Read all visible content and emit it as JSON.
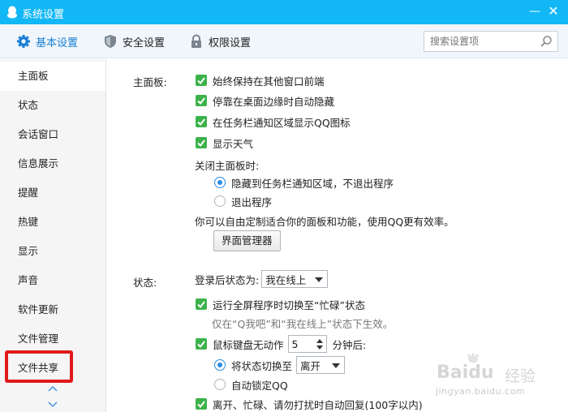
{
  "window": {
    "title": "系统设置"
  },
  "tabs": [
    {
      "label": "基本设置",
      "icon": "gear-icon",
      "active": true
    },
    {
      "label": "安全设置",
      "icon": "shield-icon",
      "active": false
    },
    {
      "label": "权限设置",
      "icon": "lock-icon",
      "active": false
    }
  ],
  "search": {
    "placeholder": "搜索设置项"
  },
  "sidebar": {
    "items": [
      {
        "label": "主面板",
        "active": true
      },
      {
        "label": "状态"
      },
      {
        "label": "会话窗口"
      },
      {
        "label": "信息展示"
      },
      {
        "label": "提醒"
      },
      {
        "label": "热键"
      },
      {
        "label": "显示"
      },
      {
        "label": "声音"
      },
      {
        "label": "软件更新"
      },
      {
        "label": "文件管理"
      },
      {
        "label": "文件共享",
        "highlighted": true
      }
    ]
  },
  "main_panel": {
    "label": "主面板:",
    "checkboxes": [
      {
        "label": "始终保持在其他窗口前端",
        "checked": true
      },
      {
        "label": "停靠在桌面边缘时自动隐藏",
        "checked": true
      },
      {
        "label": "在任务栏通知区域显示QQ图标",
        "checked": true
      },
      {
        "label": "显示天气",
        "checked": true
      }
    ],
    "close_label": "关闭主面板时:",
    "close_options": [
      {
        "label": "隐藏到任务栏通知区域，不退出程序",
        "selected": true
      },
      {
        "label": "退出程序",
        "selected": false
      }
    ],
    "customize_text": "你可以自由定制适合你的面板和功能，使用QQ更有效率。",
    "manager_button": "界面管理器"
  },
  "status_panel": {
    "label": "状态:",
    "login_status_label": "登录后状态为:",
    "login_status_value": "我在线上",
    "fullscreen_busy": {
      "label": "运行全屏程序时切换至“忙碌”状态",
      "checked": true
    },
    "fullscreen_hint": "仅在“Q我吧”和“我在线上”状态下生效。",
    "idle_label": "鼠标键盘无动作",
    "idle_minutes": "5",
    "idle_suffix": "分钟后:",
    "idle_checked": true,
    "idle_options": [
      {
        "label": "将状态切换至",
        "selected": true,
        "select_value": "离开"
      },
      {
        "label": "自动锁定QQ",
        "selected": false
      }
    ],
    "auto_reply": {
      "label": "离开、忙碌、请勿打扰时自动回复(100字以内)",
      "checked": true
    }
  },
  "watermark": {
    "logo": "Baidu",
    "cn": "经验",
    "url": "jingyan.baidu.com"
  },
  "colors": {
    "titlebar": "#12b7f5",
    "accent": "#1a7fd5",
    "checkbox": "#3cb24a",
    "highlight_box": "#e01a1a"
  }
}
